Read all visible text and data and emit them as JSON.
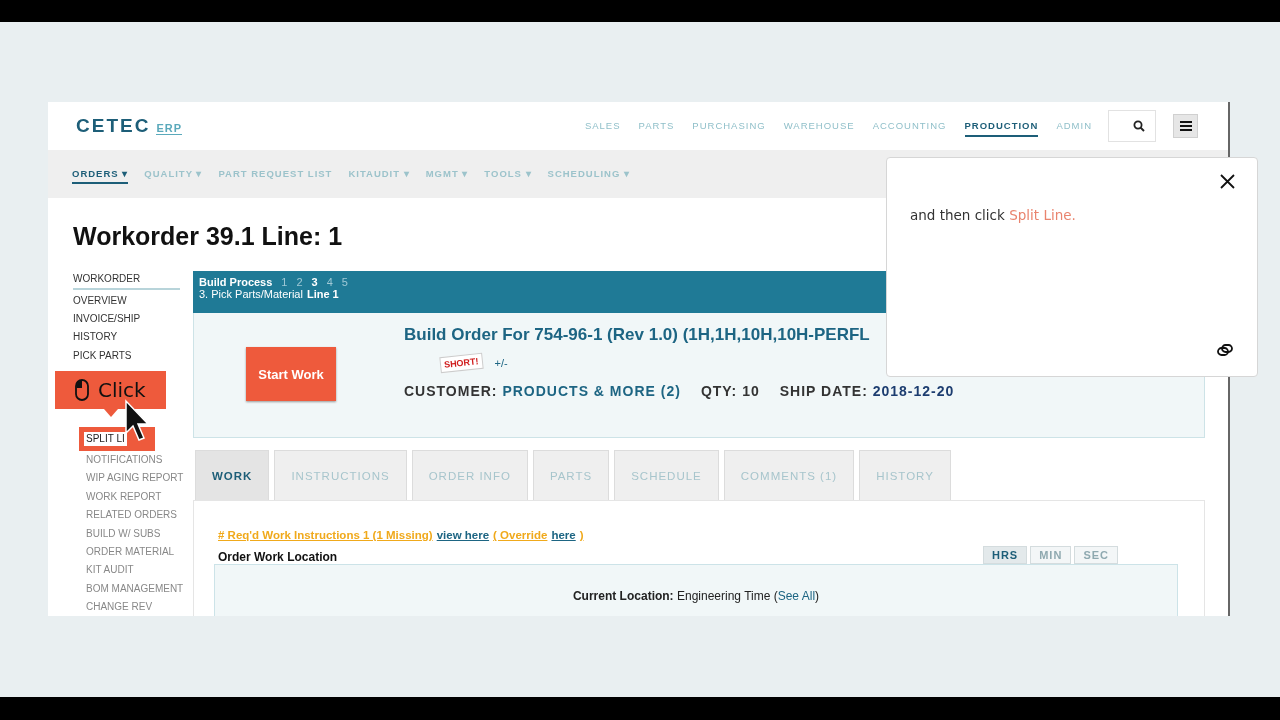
{
  "logo": {
    "name": "CETEC",
    "suffix": "ERP"
  },
  "top_nav": [
    {
      "label": "SALES",
      "selected": false
    },
    {
      "label": "PARTS",
      "selected": false
    },
    {
      "label": "PURCHASING",
      "selected": false
    },
    {
      "label": "WAREHOUSE",
      "selected": false
    },
    {
      "label": "ACCOUNTING",
      "selected": false
    },
    {
      "label": "PRODUCTION",
      "selected": true
    },
    {
      "label": "ADMIN",
      "selected": false
    }
  ],
  "sub_nav": [
    {
      "label": "ORDERS ▾",
      "selected": true
    },
    {
      "label": "QUALITY ▾",
      "selected": false
    },
    {
      "label": "PART REQUEST LIST",
      "selected": false
    },
    {
      "label": "KITAUDIT ▾",
      "selected": false
    },
    {
      "label": "MGMT ▾",
      "selected": false
    },
    {
      "label": "TOOLS ▾",
      "selected": false
    },
    {
      "label": "SCHEDULING ▾",
      "selected": false
    }
  ],
  "page_title": "Workorder 39.1 Line: 1",
  "sidebar": {
    "items": [
      {
        "label": "WORKORDER",
        "selected": true
      },
      {
        "label": "OVERVIEW",
        "selected": false
      },
      {
        "label": "INVOICE/SHIP",
        "selected": false
      },
      {
        "label": "HISTORY",
        "selected": false
      },
      {
        "label": "PICK PARTS",
        "selected": false
      }
    ],
    "sub_items": [
      {
        "label": "SPLIT LI",
        "highlighted": true
      },
      {
        "label": "NOTIFICATIONS",
        "highlighted": false
      },
      {
        "label": "WIP AGING REPORT",
        "highlighted": false
      },
      {
        "label": "WORK REPORT",
        "highlighted": false
      },
      {
        "label": "RELATED ORDERS",
        "highlighted": false
      },
      {
        "label": "BUILD W/ SUBS",
        "highlighted": false
      },
      {
        "label": "ORDER MATERIAL",
        "highlighted": false
      },
      {
        "label": "KIT AUDIT",
        "highlighted": false
      },
      {
        "label": "BOM MANAGEMENT",
        "highlighted": false
      },
      {
        "label": "CHANGE REV",
        "highlighted": false
      }
    ]
  },
  "build_process": {
    "label": "Build Process",
    "steps": [
      {
        "label": "1",
        "selected": false
      },
      {
        "label": "2",
        "selected": false
      },
      {
        "label": "3",
        "selected": true
      },
      {
        "label": "4",
        "selected": false
      },
      {
        "label": "5",
        "selected": false
      }
    ],
    "step_name": "3. Pick Parts/Material",
    "line": "Line 1"
  },
  "order": {
    "start_button": "Start Work",
    "title": "Build Order For 754-96-1 (Rev 1.0) (1H,1H,10H,10H-PERFL",
    "short_stamp": "SHORT!",
    "adjust_link": "+/-",
    "fields": [
      {
        "label": "CUSTOMER:",
        "value": "PRODUCTS & MORE (2)",
        "kind": "link"
      },
      {
        "label": "QTY:",
        "value": "10",
        "kind": "plain"
      },
      {
        "label": "SHIP DATE:",
        "value": "2018-12-20",
        "kind": "date"
      }
    ]
  },
  "tabs": [
    {
      "label": "WORK",
      "selected": true
    },
    {
      "label": "INSTRUCTIONS",
      "selected": false
    },
    {
      "label": "ORDER INFO",
      "selected": false
    },
    {
      "label": "PARTS",
      "selected": false
    },
    {
      "label": "SCHEDULE",
      "selected": false
    },
    {
      "label": "COMMENTS (1)",
      "selected": false
    },
    {
      "label": "HISTORY",
      "selected": false
    }
  ],
  "work": {
    "notice": [
      {
        "text": "# Req'd Work Instructions 1 (1 Missing)",
        "kind": "warning"
      },
      {
        "text": "view here",
        "kind": "link"
      },
      {
        "text": "( Override",
        "kind": "warning"
      },
      {
        "text": "here",
        "kind": "link"
      },
      {
        "text": ")",
        "kind": "warning"
      }
    ],
    "location_heading": "Order Work Location",
    "units": [
      {
        "label": "HRS",
        "selected": true
      },
      {
        "label": "MIN",
        "selected": false
      },
      {
        "label": "SEC",
        "selected": false
      }
    ],
    "current_location": {
      "label": "Current Location:",
      "before": "Engineering Time (",
      "link": "See All",
      "after": ")"
    }
  },
  "callout": {
    "label": "Click"
  },
  "tooltip": {
    "text": "and then click ",
    "highlight": "Split Line."
  }
}
